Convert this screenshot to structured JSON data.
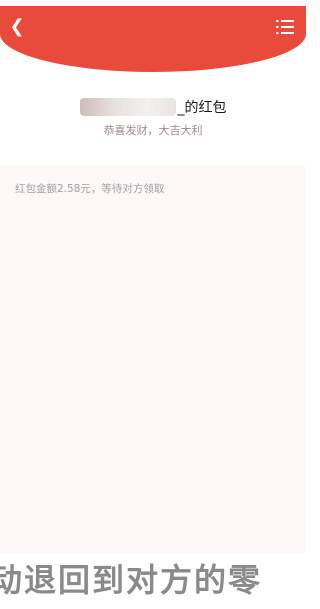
{
  "header": {
    "back_icon": "chevron-left-icon",
    "menu_icon": "list-icon",
    "accent_color": "#e84b3c"
  },
  "packet": {
    "title_suffix": "_的红包",
    "subtitle": "恭喜发财，大吉大利",
    "status_text": "红包金额2.58元，等待对方领取"
  },
  "caption": {
    "text": "动退回到对方的零"
  }
}
